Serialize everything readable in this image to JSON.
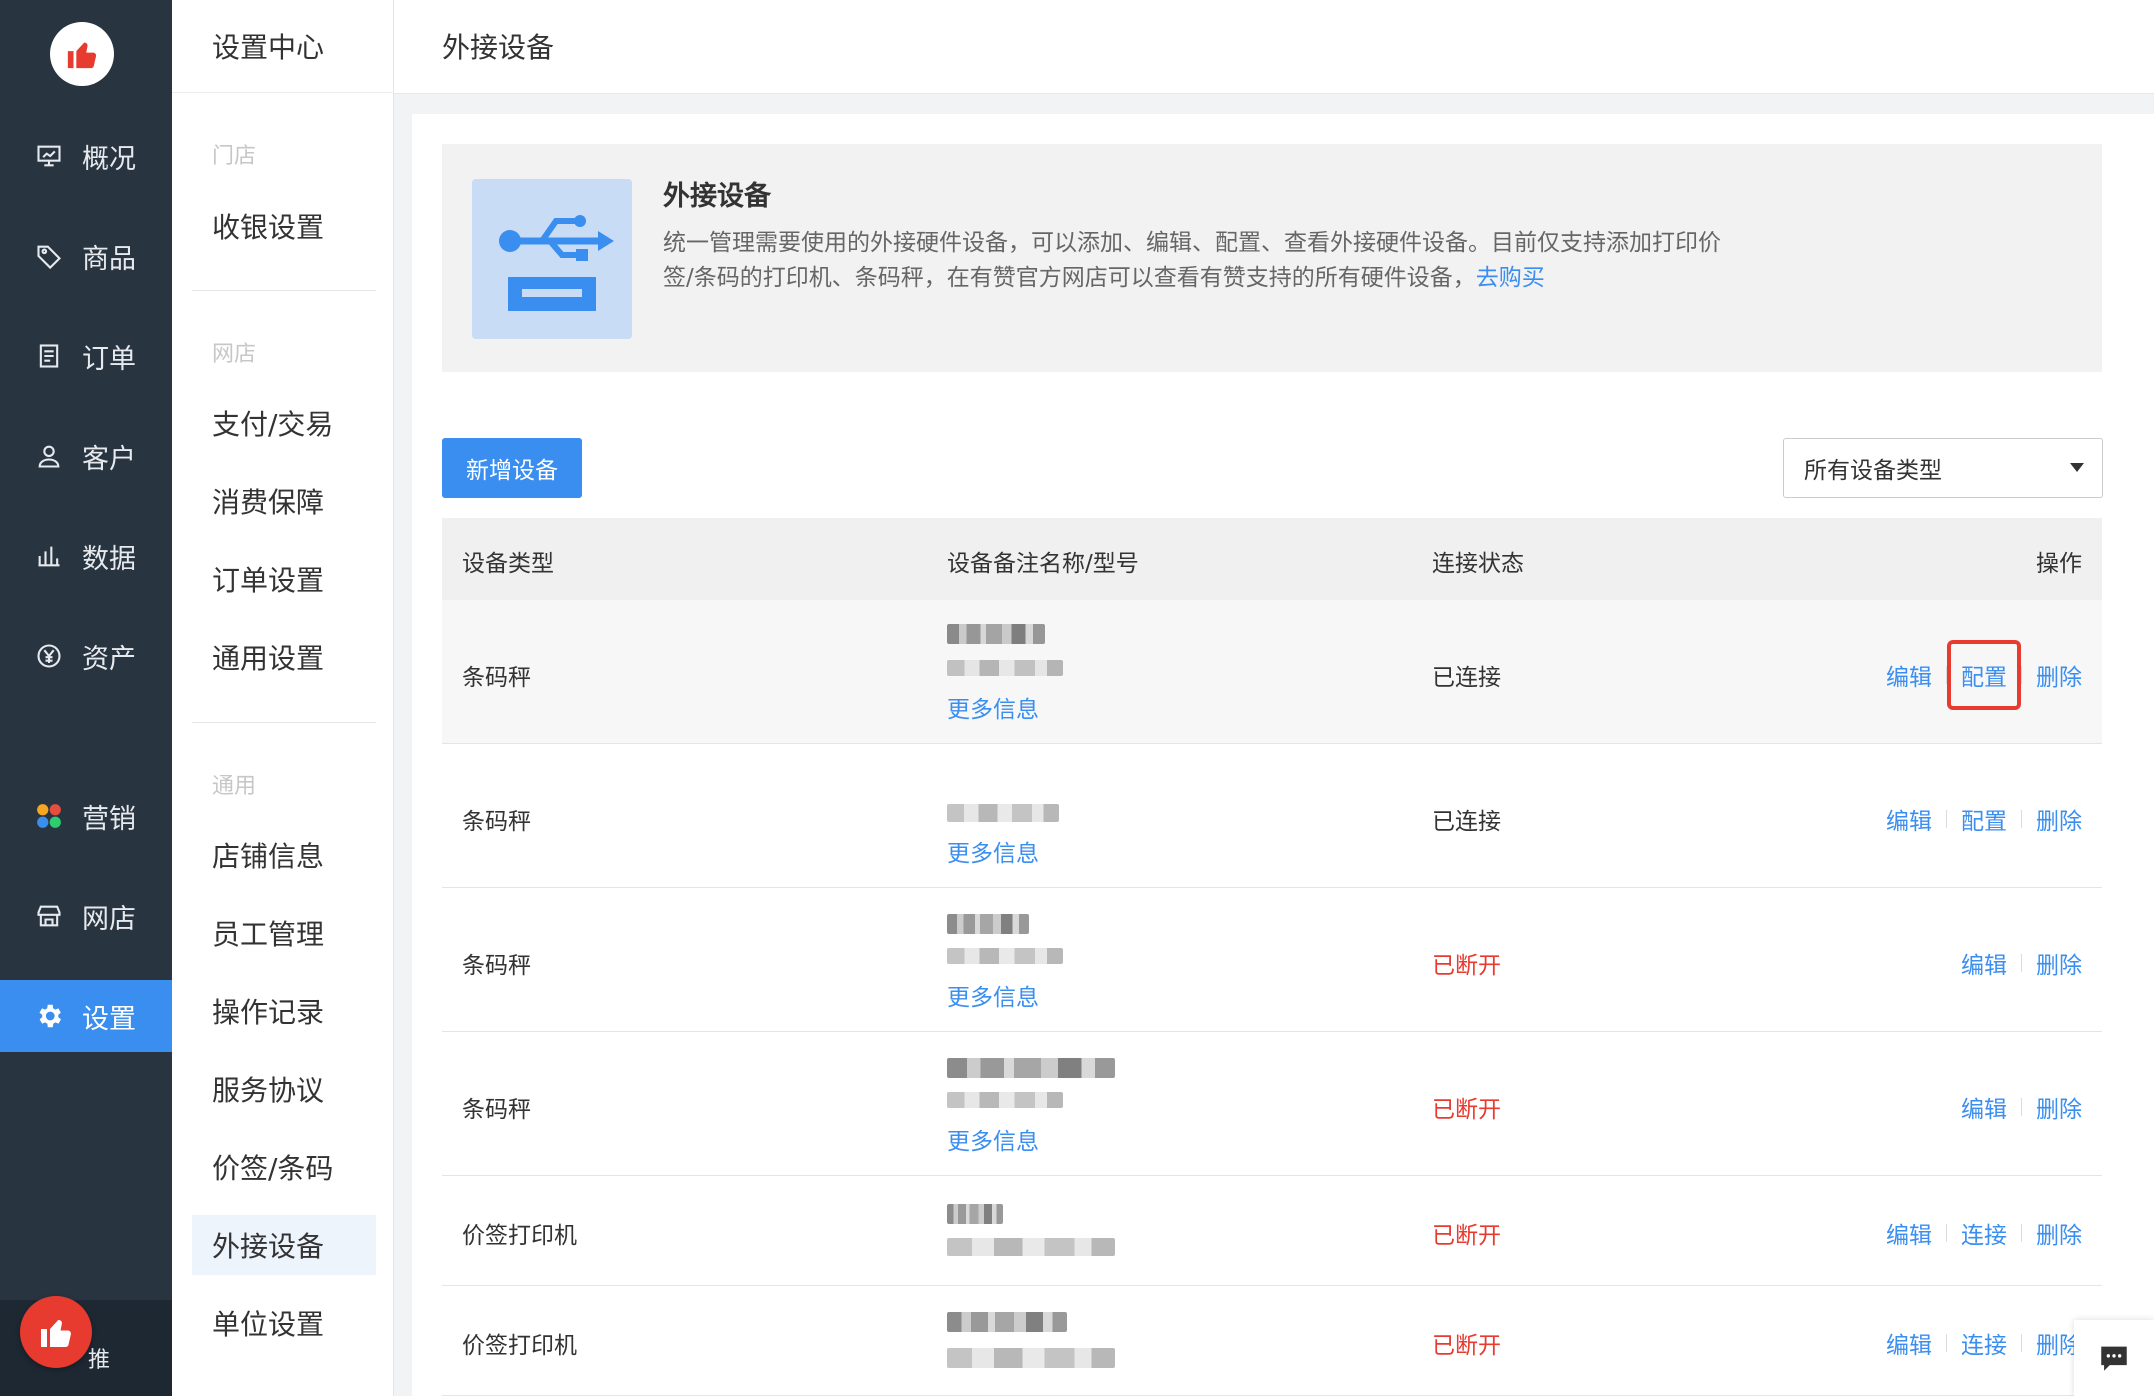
{
  "nav": {
    "items": [
      {
        "label": "概况",
        "icon": "dashboard-icon"
      },
      {
        "label": "商品",
        "icon": "tag-icon"
      },
      {
        "label": "订单",
        "icon": "order-icon"
      },
      {
        "label": "客户",
        "icon": "user-icon"
      },
      {
        "label": "数据",
        "icon": "bar-chart-icon"
      },
      {
        "label": "资产",
        "icon": "yuan-icon"
      },
      {
        "label": "营销",
        "icon": "marketing-icon"
      },
      {
        "label": "网店",
        "icon": "store-icon"
      },
      {
        "label": "设置",
        "icon": "gear-icon"
      }
    ],
    "bottom_label": "推"
  },
  "submenu": {
    "title": "设置中心",
    "groups": [
      {
        "label": "门店",
        "items": [
          "收银设置"
        ]
      },
      {
        "label": "网店",
        "items": [
          "支付/交易",
          "消费保障",
          "订单设置",
          "通用设置"
        ]
      },
      {
        "label": "通用",
        "items": [
          "店铺信息",
          "员工管理",
          "操作记录",
          "服务协议",
          "价签/条码",
          "外接设备",
          "单位设置"
        ]
      }
    ],
    "active": "外接设备"
  },
  "header": {
    "title": "外接设备"
  },
  "intro": {
    "title": "外接设备",
    "desc": "统一管理需要使用的外接硬件设备，可以添加、编辑、配置、查看外接硬件设备。目前仅支持添加打印价签/条码的打印机、条码秤，在有赞官方网店可以查看有赞支持的所有硬件设备，",
    "link": "去购买"
  },
  "toolbar": {
    "add_label": "新增设备",
    "filter_value": "所有设备类型"
  },
  "table": {
    "headers": [
      "设备类型",
      "设备备注名称/型号",
      "连接状态",
      "操作"
    ],
    "more_label": "更多信息",
    "rows": [
      {
        "type": "条码秤",
        "status": "已连接",
        "status_kind": "ok",
        "ops": [
          "编辑",
          "配置",
          "删除"
        ]
      },
      {
        "type": "条码秤",
        "status": "已连接",
        "status_kind": "ok",
        "ops": [
          "编辑",
          "配置",
          "删除"
        ]
      },
      {
        "type": "条码秤",
        "status": "已断开",
        "status_kind": "bad",
        "ops": [
          "编辑",
          "删除"
        ]
      },
      {
        "type": "条码秤",
        "status": "已断开",
        "status_kind": "bad",
        "ops": [
          "编辑",
          "删除"
        ]
      },
      {
        "type": "价签打印机",
        "status": "已断开",
        "status_kind": "bad",
        "ops": [
          "编辑",
          "连接",
          "删除"
        ]
      },
      {
        "type": "价签打印机",
        "status": "已断开",
        "status_kind": "bad",
        "ops": [
          "编辑",
          "连接",
          "删除"
        ]
      }
    ]
  },
  "colors": {
    "primary": "#3a8ef0",
    "danger": "#e73b30",
    "nav_bg": "#283440"
  }
}
